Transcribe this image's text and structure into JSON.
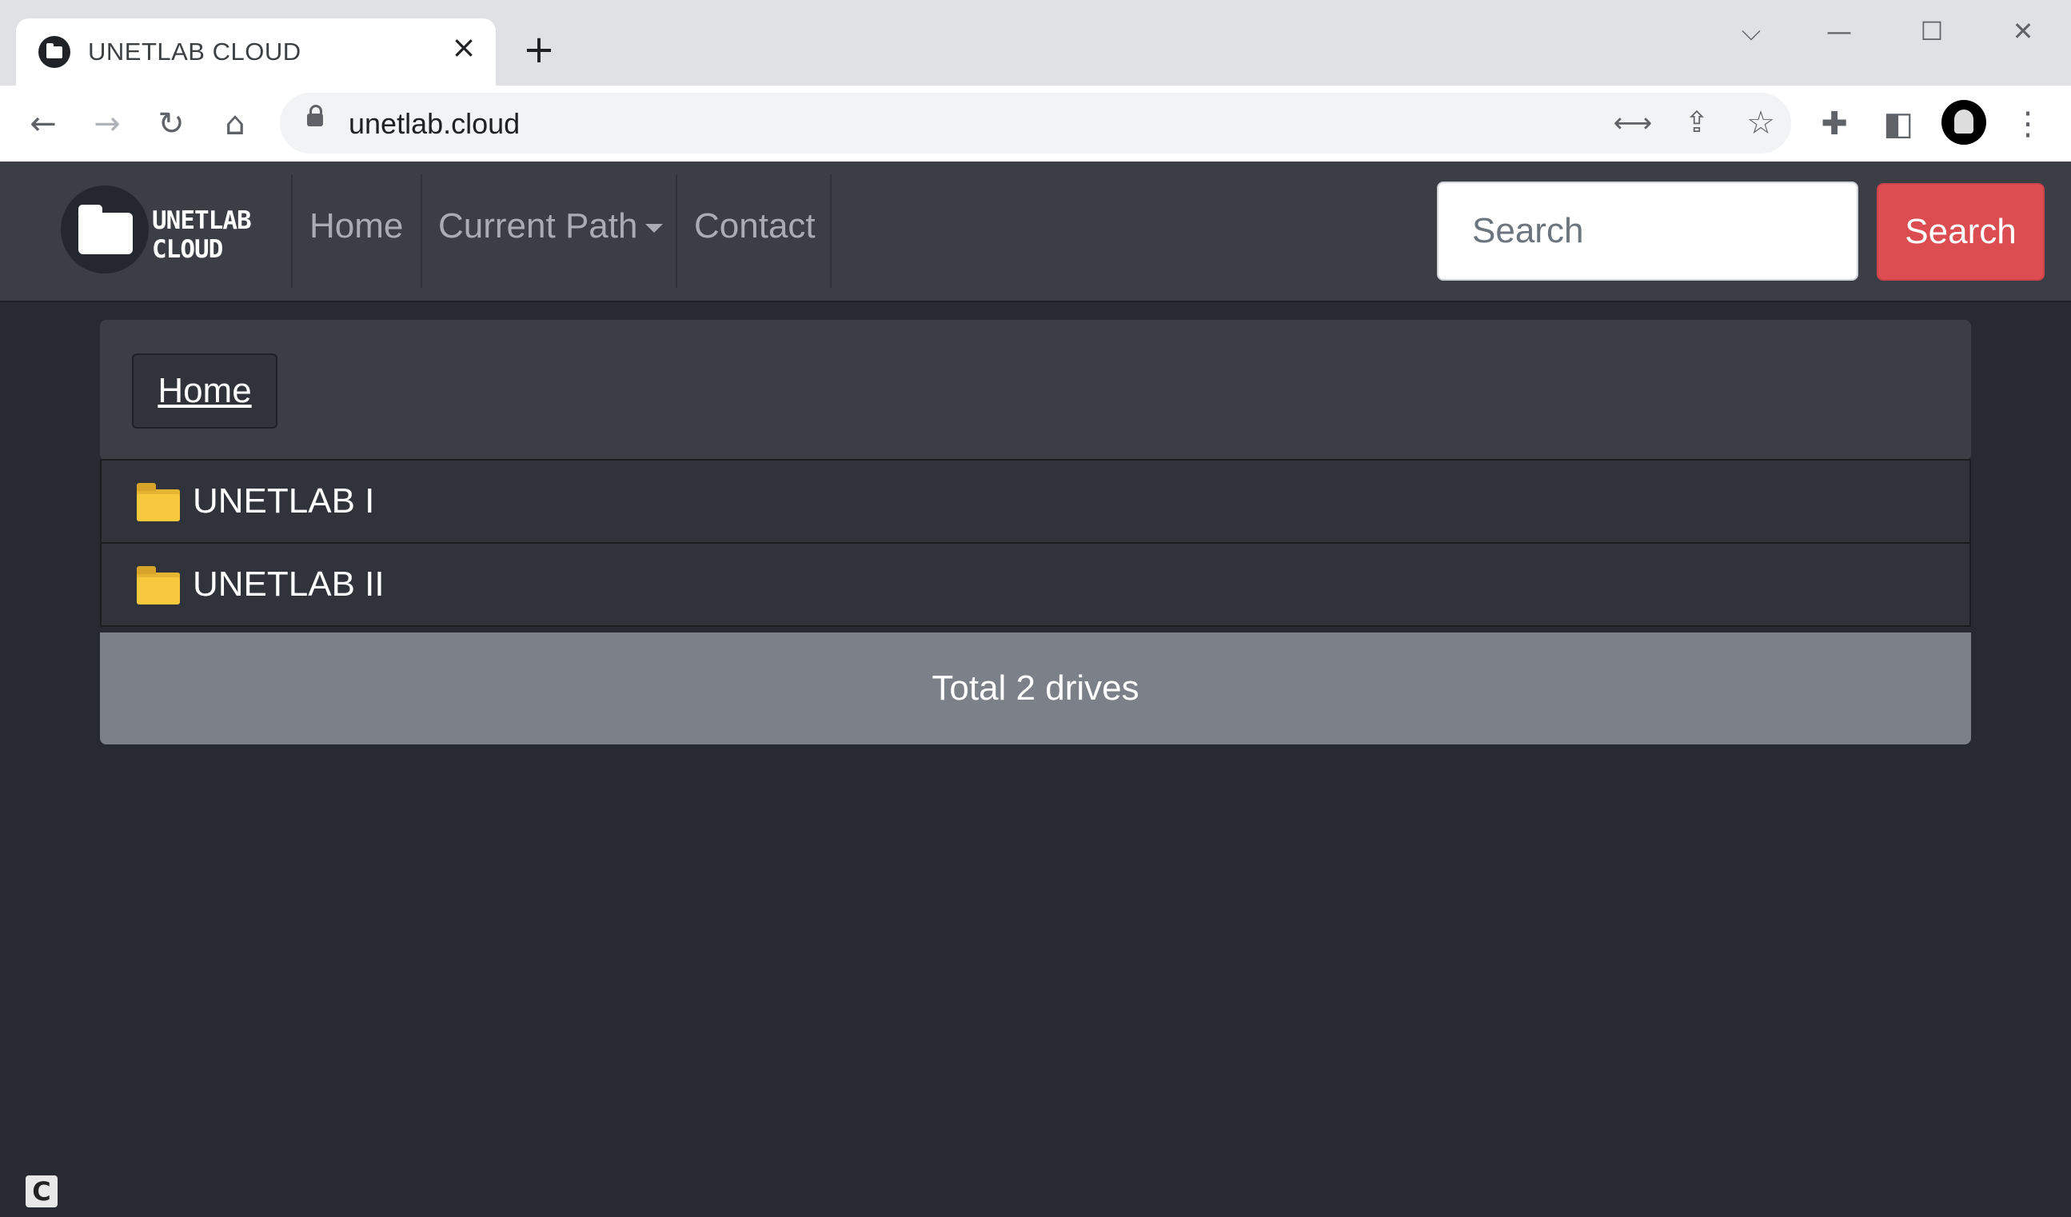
{
  "browser": {
    "tab_title": "UNETLAB CLOUD",
    "tab_close": "×",
    "new_tab": "+",
    "window_controls": {
      "collapse": "⌵",
      "minimize": "—",
      "maximize": "☐",
      "close": "✕"
    },
    "nav_icons": {
      "back": "←",
      "forward": "→",
      "reload": "↻",
      "home": "⌂"
    },
    "url": "unetlab.cloud",
    "toolbar_icons": {
      "translate": "⟷",
      "share": "⇪",
      "star": "☆",
      "extensions": "✚",
      "sidepanel": "◧",
      "menu": "⋮"
    }
  },
  "navbar": {
    "brand_line1": "UNETLAB",
    "brand_line2": "CLOUD",
    "links": [
      "Home",
      "Current Path",
      "Contact"
    ],
    "search_placeholder": "Search",
    "search_button": "Search",
    "search_button_color": "#dc4d52"
  },
  "breadcrumb": {
    "home": "Home"
  },
  "drives": [
    {
      "label": "UNETLAB I",
      "icon": "folder-icon"
    },
    {
      "label": "UNETLAB II",
      "icon": "folder-icon"
    }
  ],
  "footer": {
    "total": "Total 2 drives"
  },
  "corner_logo": "C"
}
